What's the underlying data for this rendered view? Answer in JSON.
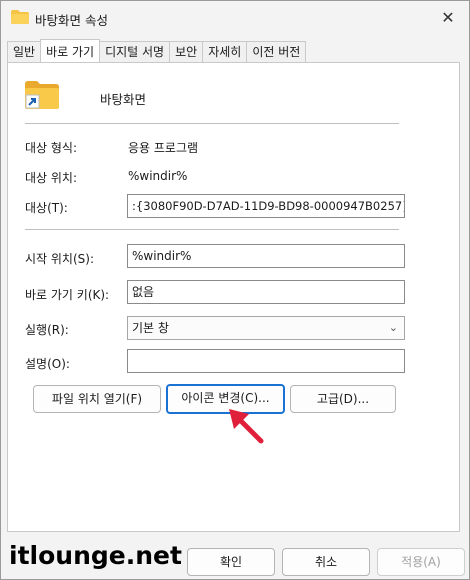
{
  "window": {
    "title": "바탕화면 속성",
    "close_glyph": "✕"
  },
  "tabs": [
    {
      "label": "일반",
      "active": false
    },
    {
      "label": "바로 가기",
      "active": true
    },
    {
      "label": "디지털 서명",
      "active": false
    },
    {
      "label": "보안",
      "active": false
    },
    {
      "label": "자세히",
      "active": false
    },
    {
      "label": "이전 버전",
      "active": false
    }
  ],
  "shortcut": {
    "name": "바탕화면",
    "target_type_label": "대상 형식:",
    "target_type_value": "응용 프로그램",
    "target_location_label": "대상 위치:",
    "target_location_value": "%windir%",
    "target_label": "대상(T):",
    "target_value": ":{3080F90D-D7AD-11D9-BD98-0000947B0257}",
    "start_in_label": "시작 위치(S):",
    "start_in_value": "%windir%",
    "hotkey_label": "바로 가기 키(K):",
    "hotkey_value": "없음",
    "run_label": "실행(R):",
    "run_value": "기본 창",
    "comment_label": "설명(O):",
    "comment_value": ""
  },
  "buttons": {
    "open_location": "파일 위치 열기(F)",
    "change_icon": "아이콘 변경(C)...",
    "advanced": "고급(D)..."
  },
  "footer": {
    "ok": "확인",
    "cancel": "취소",
    "apply": "적용(A)"
  },
  "watermark": "itlounge.net",
  "colors": {
    "arrow": "#e0203a",
    "focus": "#1a73d4",
    "folder": "#f6c445"
  }
}
